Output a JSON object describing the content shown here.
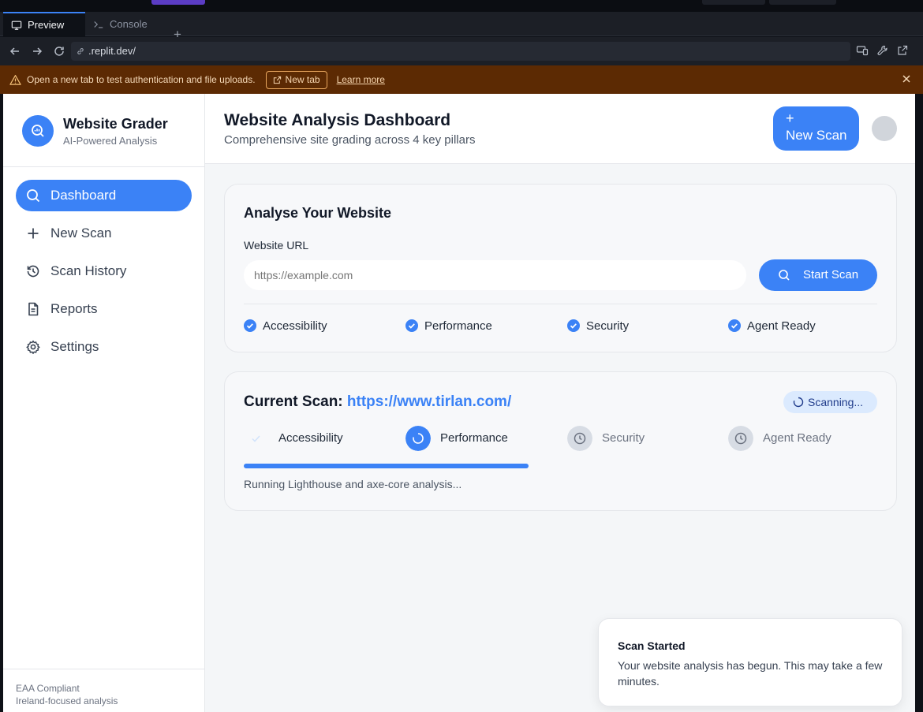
{
  "ide": {
    "tabs": [
      {
        "label": "Preview",
        "icon": "monitor-icon"
      },
      {
        "label": "Console",
        "icon": "terminal-icon"
      }
    ],
    "add_tab_label": "+",
    "url": ".replit.dev/",
    "warning": {
      "message": "Open a new tab to test authentication and file uploads.",
      "new_tab_label": "New tab",
      "learn_more_label": "Learn more"
    }
  },
  "sidebar": {
    "brand_name": "Website Grader",
    "brand_sub": "AI-Powered Analysis",
    "items": [
      {
        "label": "Dashboard",
        "icon": "search-icon",
        "active": true
      },
      {
        "label": "New Scan",
        "icon": "plus-icon"
      },
      {
        "label": "Scan History",
        "icon": "history-icon"
      },
      {
        "label": "Reports",
        "icon": "document-icon"
      },
      {
        "label": "Settings",
        "icon": "gear-icon"
      }
    ],
    "footer": [
      "EAA Compliant",
      "Ireland-focused analysis"
    ]
  },
  "header": {
    "title": "Website Analysis Dashboard",
    "subtitle": "Comprehensive site grading across 4 key pillars",
    "new_scan_plus": "+",
    "new_scan_label": "New Scan"
  },
  "analyse": {
    "title": "Analyse Your Website",
    "url_label": "Website URL",
    "url_placeholder": "https://example.com",
    "start_label": "Start Scan",
    "options": [
      "Accessibility",
      "Performance",
      "Security",
      "Agent Ready"
    ]
  },
  "current_scan": {
    "title_prefix": "Current Scan:",
    "url": "https://www.tirlan.com/",
    "status": "Scanning...",
    "steps": [
      {
        "label": "Accessibility",
        "state": "done"
      },
      {
        "label": "Performance",
        "state": "running"
      },
      {
        "label": "Security",
        "state": "pending"
      },
      {
        "label": "Agent Ready",
        "state": "pending"
      }
    ],
    "progress_fraction": 0.45,
    "progress_text": "Running Lighthouse and axe-core analysis..."
  },
  "toast": {
    "title": "Scan Started",
    "body": "Your website analysis has begun. This may take a few minutes."
  },
  "colors": {
    "accent": "#3b82f6",
    "warning_bg": "#5c2a03",
    "ide_bg": "#1c1f26"
  }
}
